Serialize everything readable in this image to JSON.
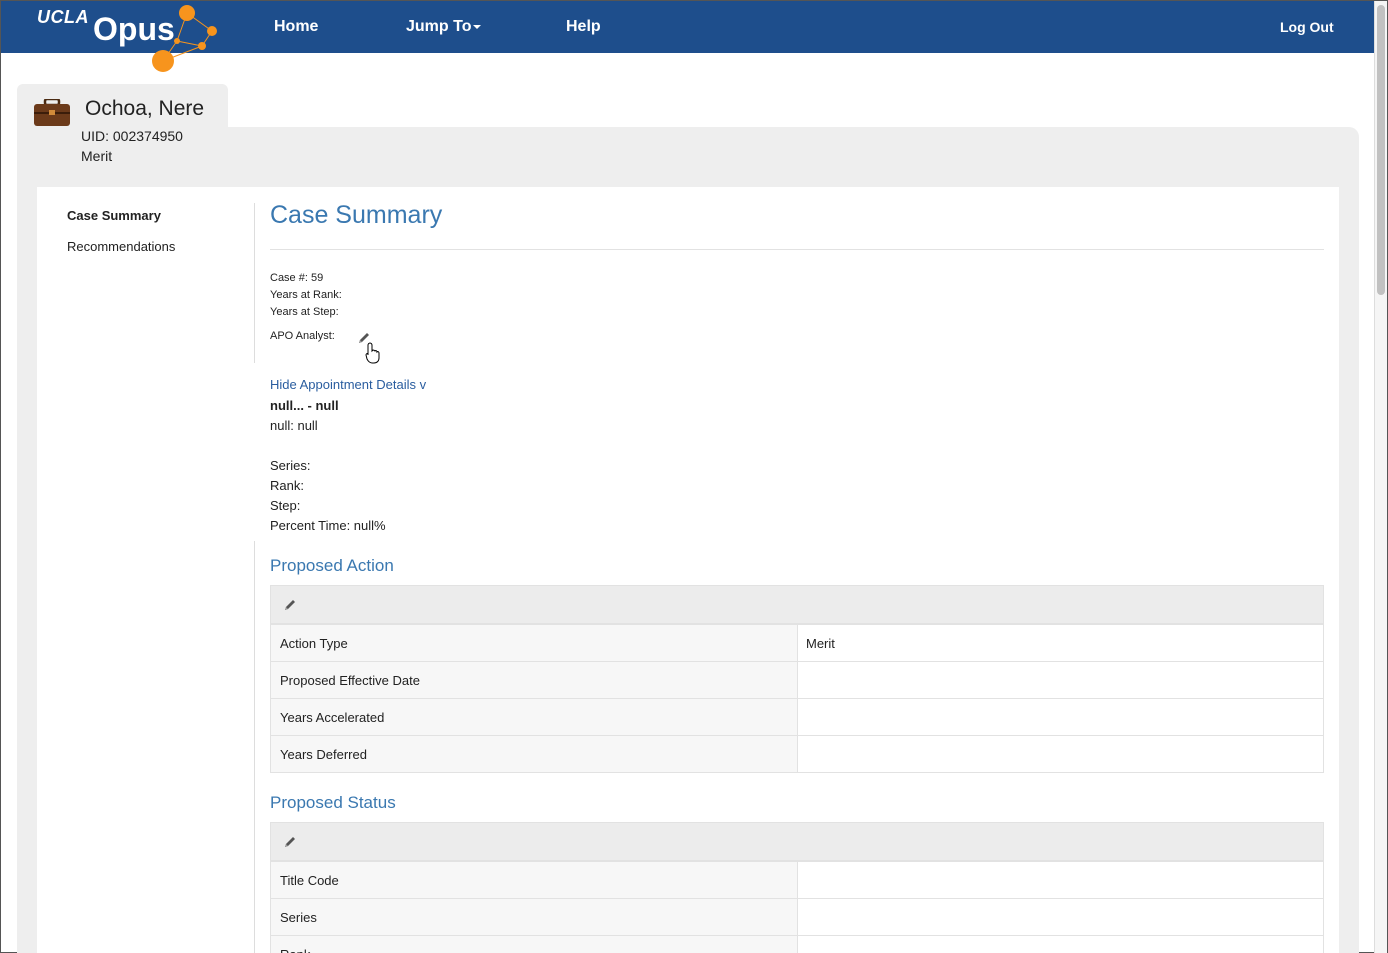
{
  "nav": {
    "logo_ucla": "UCLA",
    "logo_opus": "Opus",
    "home": "Home",
    "jump_to": "Jump To",
    "help": "Help",
    "log_out": "Log Out",
    "brand_color": "#1e4e8c",
    "accent_color": "#f7941d"
  },
  "profile": {
    "name": "Ochoa, Nere",
    "uid_label": "UID:",
    "uid": "002374950",
    "action": "Merit",
    "icon": "briefcase-icon"
  },
  "sidebar": {
    "items": [
      {
        "label": "Case Summary",
        "active": true
      },
      {
        "label": "Recommendations",
        "active": false
      }
    ]
  },
  "main": {
    "title": "Case Summary",
    "case_number": "Case #: 59",
    "years_at_rank": "Years at Rank:",
    "years_at_step": "Years at Step:",
    "apo_analyst": "APO Analyst:",
    "toggle_details": "Hide Appointment Details v",
    "appointment_title": "null... - null",
    "appointment_line": "null: null",
    "series": "Series:",
    "rank": "Rank:",
    "step": "Step:",
    "percent_time": "Percent Time: null%"
  },
  "proposed_action": {
    "title": "Proposed Action",
    "rows": [
      {
        "label": "Action Type",
        "value": "Merit"
      },
      {
        "label": "Proposed Effective Date",
        "value": ""
      },
      {
        "label": "Years Accelerated",
        "value": ""
      },
      {
        "label": "Years Deferred",
        "value": ""
      }
    ]
  },
  "proposed_status": {
    "title": "Proposed Status",
    "rows": [
      {
        "label": "Title Code",
        "value": ""
      },
      {
        "label": "Series",
        "value": ""
      },
      {
        "label": "Rank",
        "value": ""
      }
    ]
  }
}
